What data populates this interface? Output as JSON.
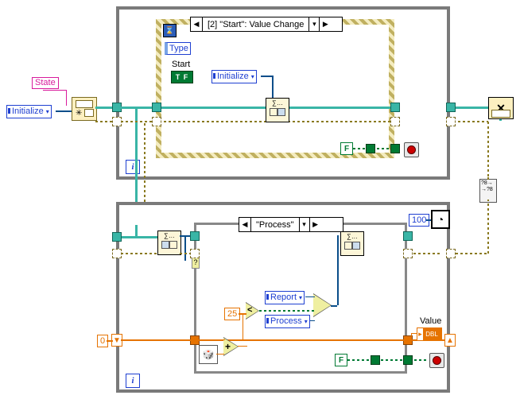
{
  "labels": {
    "state": "State",
    "initialize_const": "Initialize",
    "type": "Type",
    "start": "Start",
    "tf": "T F",
    "event_initialize": "Initialize",
    "event_selector": "[2] \"Start\": Value Change",
    "case_selector": "\"Process\"",
    "false": "F",
    "num100": "100",
    "num25": "25",
    "num0": "0",
    "report": "Report",
    "process": "Process",
    "value": "Value",
    "dbl": "DBL",
    "subvi": "∑…",
    "conv": "?8→\n→?8"
  },
  "chart_data": {
    "type": "diagram",
    "description": "LabVIEW block diagram: producer-consumer state machine using queues",
    "loops": [
      {
        "kind": "while",
        "role": "producer",
        "contains": {
          "kind": "event-structure",
          "case": "[2] \"Start\": Value Change",
          "enqueued_state": "Initialize"
        }
      },
      {
        "kind": "while",
        "role": "consumer",
        "contains": {
          "kind": "case-structure",
          "case": "\"Process\"",
          "wait_ms": 100,
          "logic": {
            "compare_to": 25,
            "if_less": "Report",
            "else": "Process"
          },
          "shift_reg_init": 0,
          "output_indicator": "Value (DBL)"
        }
      }
    ],
    "queue": {
      "element_type_label": "State",
      "initial_enqueue": "Initialize"
    }
  }
}
